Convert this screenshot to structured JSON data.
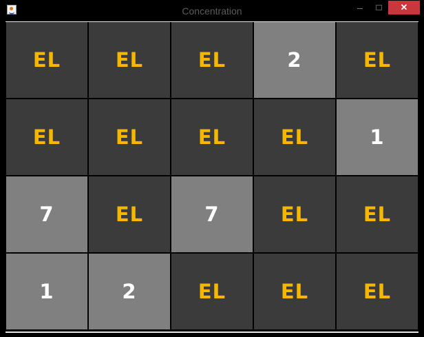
{
  "window": {
    "title": "Concentration",
    "close_glyph": "✕"
  },
  "icons": {
    "app": "java-coffee-cup-icon",
    "minimize": "minimize-icon",
    "maximize": "maximize-icon",
    "close": "close-icon"
  },
  "colors": {
    "hidden_card_bg": "#3b3b3b",
    "hidden_card_text": "#f5b800",
    "revealed_card_bg": "#808080",
    "revealed_card_text": "#ffffff"
  },
  "board": {
    "columns": 5,
    "rows": 4,
    "cards": [
      {
        "label": "EL",
        "revealed": false
      },
      {
        "label": "EL",
        "revealed": false
      },
      {
        "label": "EL",
        "revealed": false
      },
      {
        "label": "2",
        "revealed": true
      },
      {
        "label": "EL",
        "revealed": false
      },
      {
        "label": "EL",
        "revealed": false
      },
      {
        "label": "EL",
        "revealed": false
      },
      {
        "label": "EL",
        "revealed": false
      },
      {
        "label": "EL",
        "revealed": false
      },
      {
        "label": "1",
        "revealed": true
      },
      {
        "label": "7",
        "revealed": true
      },
      {
        "label": "EL",
        "revealed": false
      },
      {
        "label": "7",
        "revealed": true
      },
      {
        "label": "EL",
        "revealed": false
      },
      {
        "label": "EL",
        "revealed": false
      },
      {
        "label": "1",
        "revealed": true
      },
      {
        "label": "2",
        "revealed": true
      },
      {
        "label": "EL",
        "revealed": false
      },
      {
        "label": "EL",
        "revealed": false
      },
      {
        "label": "EL",
        "revealed": false
      }
    ]
  }
}
